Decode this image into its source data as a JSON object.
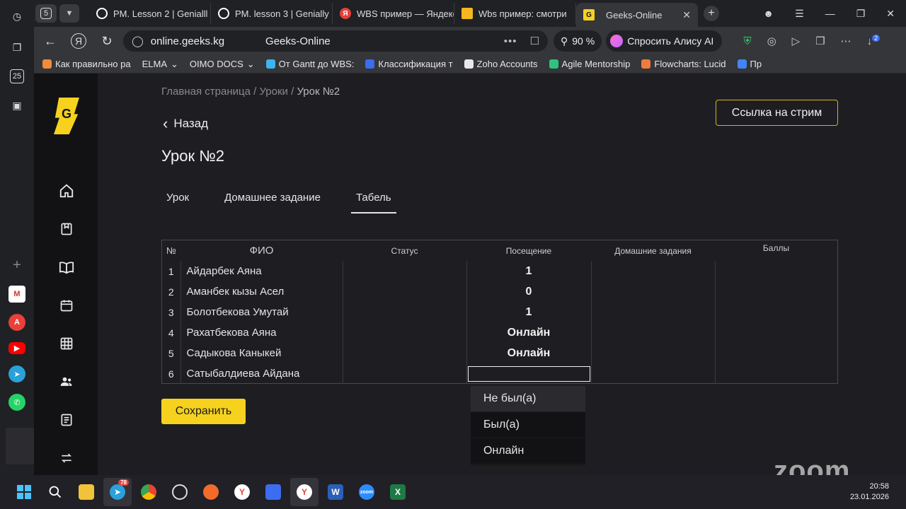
{
  "browser": {
    "tab_count": "5",
    "tabs": [
      {
        "label": "PM. Lesson 2 | Genialll",
        "favicon": "genially-icon",
        "color": "#ffffff"
      },
      {
        "label": "PM. lesson 3 | Genially",
        "favicon": "genially-icon",
        "color": "#ffffff"
      },
      {
        "label": "WBS пример — Яндекс",
        "favicon": "yandex-icon",
        "color": "#e8403a"
      },
      {
        "label": "Wbs пример: смотри",
        "favicon": "video-icon",
        "color": "#f6b81e"
      },
      {
        "label": "Geeks-Online",
        "favicon": "geeks-icon",
        "color": "#f6d21e"
      }
    ],
    "url": "online.geeks.kg",
    "page_title": "Geeks-Online",
    "zoom": "90 %",
    "alice_label": "Спросить Алису AI",
    "downloads_badge": "2",
    "bookmarks": [
      {
        "label": "Как правильно ра",
        "color": "#f08c3c"
      },
      {
        "label": "ELMA",
        "color": ""
      },
      {
        "label": "OIMO DOCS",
        "color": ""
      },
      {
        "label": "От Gantt до WBS:",
        "color": "#3cb4f0"
      },
      {
        "label": "Классификация т",
        "color": "#3c6cf0"
      },
      {
        "label": "Zoho Accounts",
        "color": "#e8e8e8"
      },
      {
        "label": "Agile Mentorship",
        "color": "#2ec27e"
      },
      {
        "label": "Flowcharts: Lucid",
        "color": "#f07c3c"
      },
      {
        "label": "Пр",
        "color": "#4285f4"
      }
    ]
  },
  "app": {
    "logo_letter": "G",
    "breadcrumb": {
      "home": "Главная страница",
      "sep": " / ",
      "lessons": "Уроки",
      "current": "Урок №2"
    },
    "back_label": "Назад",
    "stream_button": "Ссылка на стрим",
    "title": "Урок №2",
    "tabs": [
      "Урок",
      "Домашнее задание",
      "Табель"
    ],
    "active_tab": "Табель",
    "table": {
      "headers": {
        "num": "№",
        "fio": "ФИО",
        "status": "Статус",
        "attendance": "Посещение",
        "homework": "Домашние задания",
        "score": "Баллы"
      },
      "rows": [
        {
          "n": "1",
          "name": "Айдарбек Аяна",
          "attendance": "1"
        },
        {
          "n": "2",
          "name": "Аманбек кызы Асел",
          "attendance": "0"
        },
        {
          "n": "3",
          "name": "Болотбекова Умутай",
          "attendance": "1"
        },
        {
          "n": "4",
          "name": "Рахатбекова Аяна",
          "attendance": "Онлайн"
        },
        {
          "n": "5",
          "name": "Садыкова Каныкей",
          "attendance": "Онлайн"
        },
        {
          "n": "6",
          "name": "Сатыбалдиева Айдана",
          "attendance": ""
        }
      ]
    },
    "save_button": "Сохранить",
    "attendance_options": [
      "Не был(а)",
      "Был(а)",
      "Онлайн"
    ]
  },
  "overlay": {
    "zoom_watermark": "zoom"
  },
  "taskbar": {
    "telegram_badge": "78",
    "time": "20:58",
    "date": "23.01.2026"
  },
  "colors": {
    "accent": "#f6d21e",
    "stream_border": "#d4b21a"
  }
}
